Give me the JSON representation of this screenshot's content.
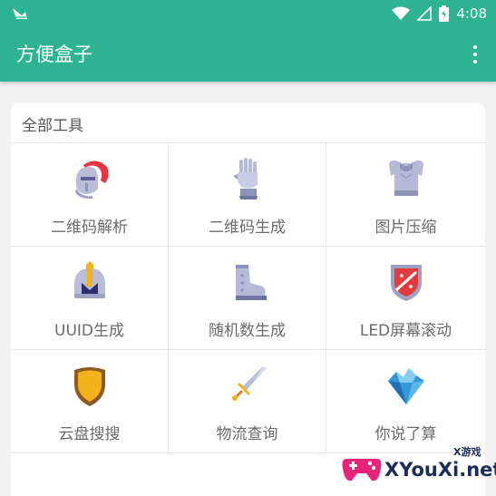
{
  "status_bar": {
    "time": "4:08",
    "icons": [
      "notification-icon",
      "wifi-icon",
      "signal-icon",
      "battery-icon"
    ]
  },
  "app_bar": {
    "title": "方便盒子",
    "menu_icon": "more-vert-icon"
  },
  "card": {
    "title": "全部工具",
    "tools": [
      {
        "label": "二维码解析",
        "icon": "helmet-icon"
      },
      {
        "label": "二维码生成",
        "icon": "gauntlet-icon"
      },
      {
        "label": "图片压缩",
        "icon": "armor-icon"
      },
      {
        "label": "UUID生成",
        "icon": "knight-helm-icon"
      },
      {
        "label": "随机数生成",
        "icon": "boot-icon"
      },
      {
        "label": "LED屏幕滚动",
        "icon": "red-shield-icon"
      },
      {
        "label": "云盘搜搜",
        "icon": "gold-shield-icon"
      },
      {
        "label": "物流查询",
        "icon": "sword-icon"
      },
      {
        "label": "你说了算",
        "icon": "crystal-icon"
      }
    ]
  },
  "watermark": {
    "brand": "XYouXi.net",
    "tag": "X游戏"
  },
  "colors": {
    "primary": "#2fb493",
    "label": "#6b6b6b"
  }
}
